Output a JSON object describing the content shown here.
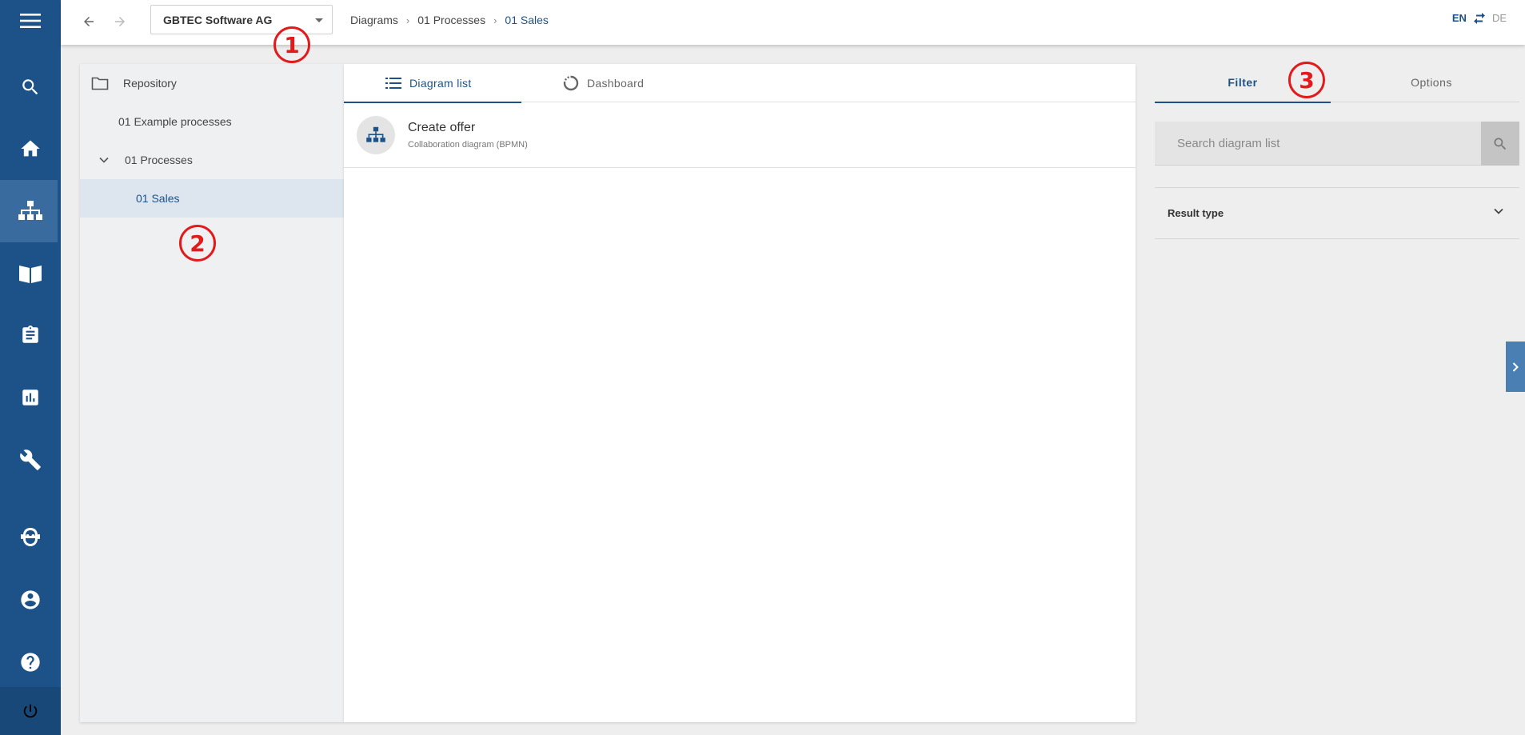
{
  "nav": {
    "menu_icon": "hamburger-menu-icon",
    "items": [
      {
        "name": "search",
        "icon": "search-icon"
      },
      {
        "name": "home",
        "icon": "home-icon"
      },
      {
        "name": "diagrams",
        "icon": "hierarchy-icon",
        "active": true
      },
      {
        "name": "book",
        "icon": "book-icon"
      },
      {
        "name": "clipboard",
        "icon": "clipboard-icon"
      },
      {
        "name": "reports",
        "icon": "bar-chart-icon"
      },
      {
        "name": "tools",
        "icon": "wrench-icon"
      },
      {
        "name": "assistant",
        "icon": "robot-icon"
      },
      {
        "name": "account",
        "icon": "account-icon"
      },
      {
        "name": "help",
        "icon": "help-icon"
      }
    ],
    "power_icon": "power-icon"
  },
  "topbar": {
    "tenant": "GBTEC Software AG",
    "breadcrumb": [
      "Diagrams",
      "01 Processes",
      "01 Sales"
    ],
    "lang_active": "EN",
    "lang_other": "DE"
  },
  "annotations": [
    "1",
    "2",
    "3"
  ],
  "tree": {
    "root": "Repository",
    "items": [
      {
        "label": "01 Example processes"
      },
      {
        "label": "01 Processes",
        "expanded": true
      },
      {
        "label": "01 Sales",
        "selected": true
      }
    ]
  },
  "main": {
    "tabs": [
      {
        "label": "Diagram list",
        "active": true
      },
      {
        "label": "Dashboard"
      }
    ],
    "rows": [
      {
        "title": "Create offer",
        "subtitle": "Collaboration diagram (BPMN)"
      }
    ]
  },
  "side": {
    "tabs": [
      {
        "label": "Filter",
        "active": true
      },
      {
        "label": "Options"
      }
    ],
    "search_placeholder": "Search diagram list",
    "result_type": "Result type"
  },
  "colors": {
    "brand": "#1d5289",
    "rail": "#1d5289",
    "annotation": "#e11b1b"
  }
}
